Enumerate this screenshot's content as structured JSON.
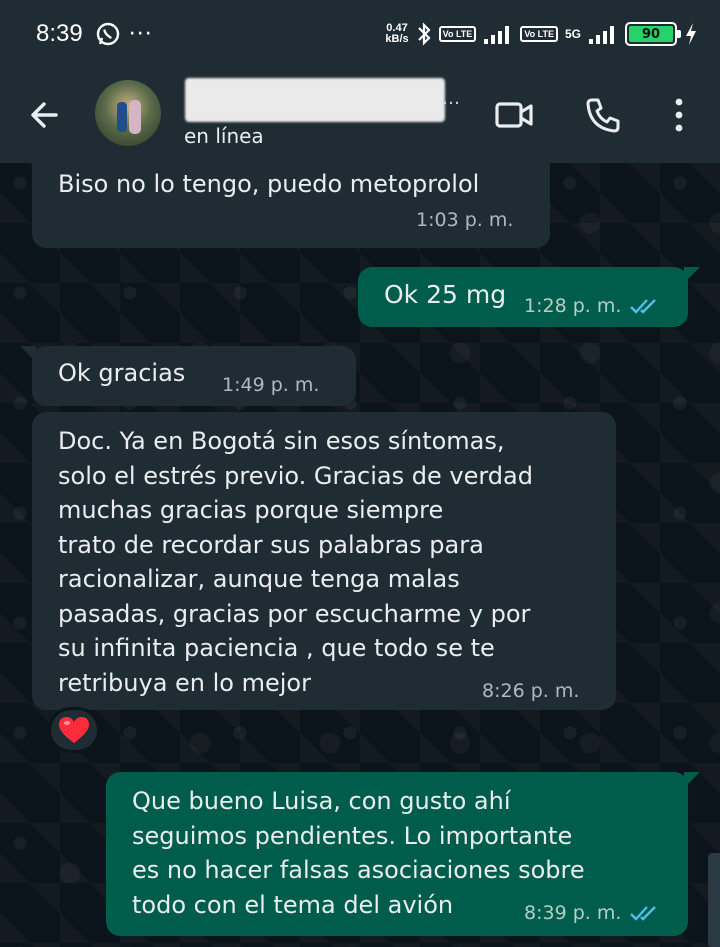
{
  "status_bar": {
    "time": "8:39",
    "speed_value": "0.47",
    "speed_unit": "kB/s",
    "volte_1": "Vo LTE",
    "volte_2": "Vo LTE",
    "network": "5G",
    "battery": "90",
    "icons": [
      "whatsapp-icon",
      "more-icon",
      "bluetooth-icon",
      "signal-icon",
      "charging-icon"
    ]
  },
  "header": {
    "status": "en línea",
    "icons": [
      "back-arrow-icon",
      "video-call-icon",
      "phone-call-icon",
      "overflow-menu-icon"
    ]
  },
  "messages": [
    {
      "direction": "in",
      "text": "Biso no lo tengo, puedo metoprolol",
      "time": "1:03 p. m."
    },
    {
      "direction": "out",
      "text": "Ok 25 mg",
      "time": "1:28 p. m.",
      "read": true
    },
    {
      "direction": "in",
      "text": "Ok gracias",
      "time": "1:49 p. m."
    },
    {
      "direction": "in",
      "text": "Doc. Ya en Bogotá sin esos síntomas,\nsolo el estrés previo. Gracias de verdad\nmuchas gracias porque siempre\ntrato de recordar sus palabras para\nracionalizar, aunque tenga malas\npasadas, gracias por escucharme y por\nsu infinita paciencia , que todo se te\nretribuya en lo mejor",
      "time": "8:26 p. m.",
      "reaction": "❤️"
    },
    {
      "direction": "out",
      "text": "Que bueno Luisa, con gusto ahí\nseguimos pendientes. Lo importante\nes no hacer falsas asociaciones sobre\ntodo con el tema del avión",
      "time": "8:39 p. m.",
      "read": true
    }
  ],
  "colors": {
    "header_bg": "#1f2c33",
    "chat_bg": "#0b141a",
    "incoming_bubble": "#1f2c33",
    "outgoing_bubble": "#005c4b",
    "read_ticks": "#53bdeb",
    "battery_fill": "#25d366"
  }
}
